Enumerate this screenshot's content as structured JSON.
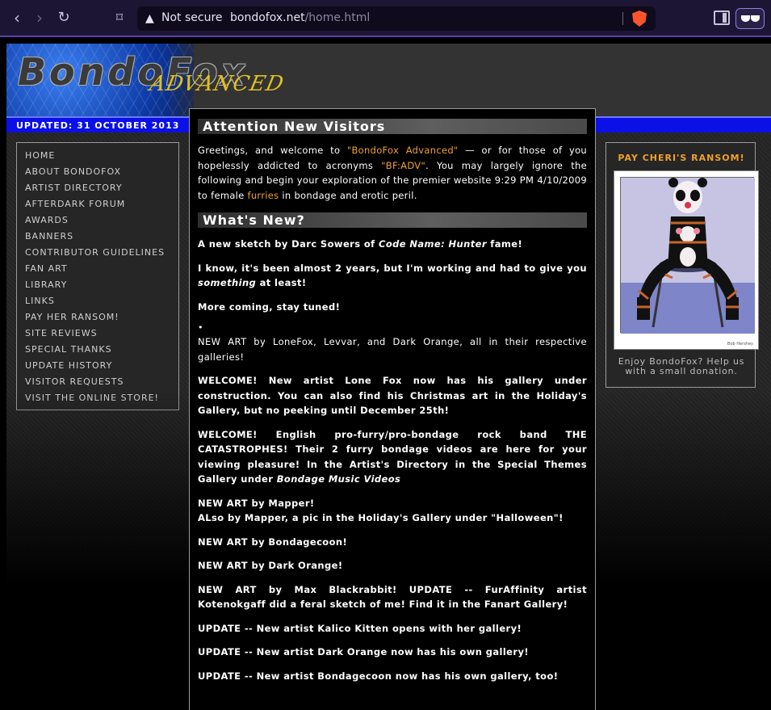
{
  "browser": {
    "security_label": "Not secure",
    "url_host": "bondofox.net",
    "url_path": "/home.html"
  },
  "site": {
    "logo_main": "BondoFox",
    "logo_sub": "ADVANCED",
    "updated": "UPDATED: 31 OCTOBER 2013"
  },
  "nav": {
    "items": [
      "HOME",
      "ABOUT BONDOFOX",
      "ARTIST DIRECTORY",
      "AFTERDARK FORUM",
      "AWARDS",
      "BANNERS",
      "CONTRIBUTOR GUIDELINES",
      "FAN ART",
      "LIBRARY",
      "LINKS",
      "PAY HER RANSOM!",
      "SITE REVIEWS",
      "SPECIAL THANKS",
      "UPDATE HISTORY",
      "VISITOR REQUESTS",
      "VISIT THE ONLINE STORE!"
    ]
  },
  "attention": {
    "heading": "Attention New Visitors",
    "t1": "Greetings, and welcome to ",
    "h1": "\"BondoFox Advanced\"",
    "t2": " — or for those of you hopelessly addicted to acronyms ",
    "h2": "\"BF:ADV\"",
    "t3": ". You may largely ignore the following and begin your exploration of the premier website 9:29 PM 4/10/2009 to female ",
    "h3": "furries",
    "t4": " in bondage and erotic peril."
  },
  "whatsnew": {
    "heading": "What's New?",
    "p1a": "A new sketch by Darc Sowers of ",
    "p1b": "Code Name: Hunter",
    "p1c": " fame!",
    "p2a": "I know, it's been almost 2 years, but I'm working and had to give you ",
    "p2b": "something",
    "p2c": " at least!",
    "p3": "More coming, stay tuned!",
    "bullet": "•",
    "p4": "NEW ART by LoneFox, Levvar, and Dark Orange, all in their respective galleries!",
    "p5": "WELCOME! New artist Lone Fox now has his gallery under construction. You can also find his Christmas art in the Holiday's Gallery, but no peeking until December 25th!",
    "p6a": "WELCOME! English pro-furry/pro-bondage rock band THE CATASTROPHES! Their 2 furry bondage videos are here for your viewing pleasure! In the Artist's Directory in the Special Themes Gallery under ",
    "p6b": "Bondage Music Videos",
    "p7a": "NEW ART by Mapper!",
    "p7b": "ALso by Mapper, a pic in the Holiday's Gallery under \"Halloween\"!",
    "p8": "NEW ART by Bondagecoon!",
    "p9": "NEW ART by Dark Orange!",
    "p10": "NEW ART by Max Blackrabbit! UPDATE -- FurAffinity artist Kotenokgaff did a feral sketch of me! Find it in the Fanart Gallery!",
    "p11": "UPDATE -- New artist Kalico Kitten opens with her gallery!",
    "p12": "UPDATE -- New artist Dark Orange now has his own gallery!",
    "p13": "UPDATE -- New artist Bondagecoon now has his own gallery, too!"
  },
  "ransom": {
    "title": "PAY CHERI'S RANSOM!",
    "signature": "Bob Hershey",
    "donate": "Enjoy BondoFox? Help us with a small donation."
  },
  "colors": {
    "accent_orange": "#f0a030",
    "updated_bar": "#0b10e8",
    "browser_chrome": "#1c1533"
  }
}
